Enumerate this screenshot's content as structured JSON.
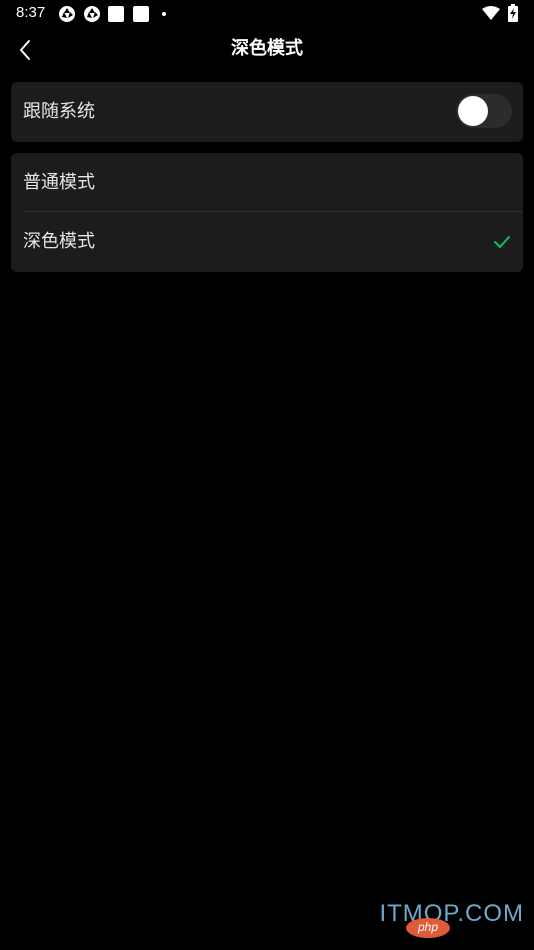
{
  "status_bar": {
    "time": "8:37",
    "icons": [
      "aperture-icon",
      "aperture-icon",
      "square-icon",
      "square-icon",
      "dot-icon",
      "wifi-icon",
      "battery-charging-icon"
    ]
  },
  "header": {
    "title": "深色模式",
    "back_icon": "chevron-left-icon"
  },
  "follow_system": {
    "label": "跟随系统",
    "enabled": false
  },
  "modes": {
    "items": [
      {
        "label": "普通模式",
        "selected": false
      },
      {
        "label": "深色模式",
        "selected": true
      }
    ],
    "check_icon": "check-icon"
  },
  "watermark": {
    "text": "ITMOP.COM",
    "badge": "php"
  },
  "colors": {
    "background": "#000000",
    "card": "#1c1c1e",
    "accent_check": "#07c160",
    "text": "#e6e6e6"
  }
}
